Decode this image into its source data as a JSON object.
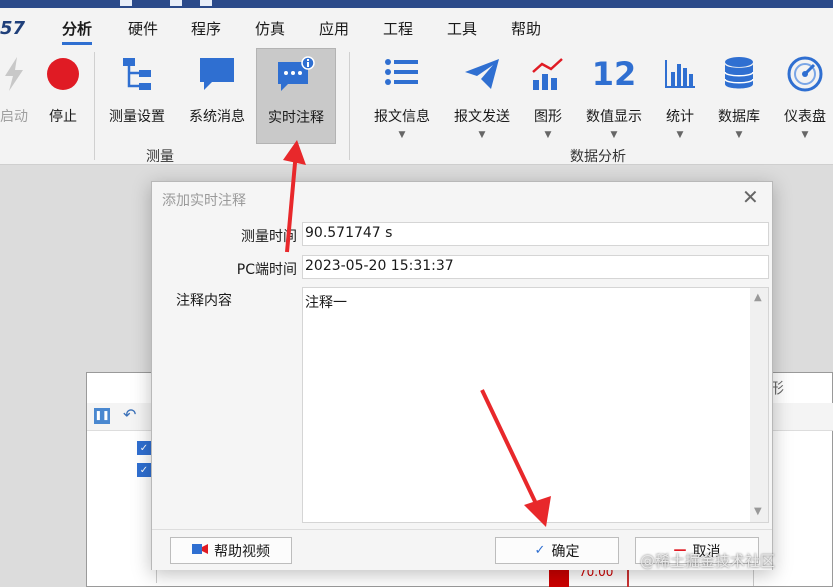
{
  "app": {
    "logo": "57"
  },
  "tabs": [
    {
      "label": "分析",
      "active": true
    },
    {
      "label": "硬件"
    },
    {
      "label": "程序"
    },
    {
      "label": "仿真"
    },
    {
      "label": "应用"
    },
    {
      "label": "工程"
    },
    {
      "label": "工具"
    },
    {
      "label": "帮助"
    }
  ],
  "ribbon": {
    "measure_group": {
      "label": "测量",
      "buttons": [
        {
          "label": "启动",
          "icon": "lightning-icon",
          "disabled": true
        },
        {
          "label": "停止",
          "icon": "stop-circle-icon"
        },
        {
          "label": "测量设置",
          "icon": "tree-icon"
        },
        {
          "label": "系统消息",
          "icon": "message-icon"
        },
        {
          "label": "实时注释",
          "icon": "comment-info-icon",
          "selected": true
        }
      ]
    },
    "analysis_group": {
      "label": "数据分析",
      "buttons": [
        {
          "label": "报文信息",
          "icon": "list-icon"
        },
        {
          "label": "报文发送",
          "icon": "send-icon"
        },
        {
          "label": "图形",
          "icon": "chart-icon"
        },
        {
          "label": "数值显示",
          "icon": "number-icon",
          "icon_text": "12"
        },
        {
          "label": "统计",
          "icon": "bar-chart-icon"
        },
        {
          "label": "数据库",
          "icon": "database-icon"
        },
        {
          "label": "仪表盘",
          "icon": "gauge-icon"
        }
      ]
    }
  },
  "background_window": {
    "title_fragment": "形",
    "value_fragment": "70.00"
  },
  "dialog": {
    "title": "添加实时注释",
    "measure_time_label": "测量时间",
    "measure_time_value": "90.571747 s",
    "pc_time_label": "PC端时间",
    "pc_time_value": "2023-05-20 15:31:37",
    "comment_label": "注释内容",
    "comment_value": "注释一",
    "help_button": "帮助视频",
    "ok_button": "确定",
    "cancel_button": "取消"
  },
  "watermark": "@稀土掘金技术社区",
  "colors": {
    "accent": "#2f6fd1",
    "stop_red": "#e01b24",
    "arrow_red": "#e8282b"
  }
}
